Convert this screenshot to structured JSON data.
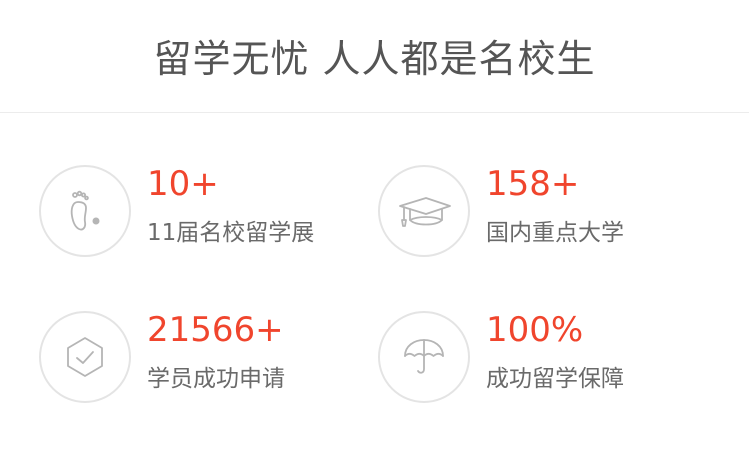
{
  "header": {
    "title": "留学无忧 人人都是名校生"
  },
  "stats": [
    {
      "value": "10+",
      "label": "11届名校留学展",
      "icon": "footprint-icon"
    },
    {
      "value": "158+",
      "label": "国内重点大学",
      "icon": "graduation-cap-icon"
    },
    {
      "value": "21566+",
      "label": "学员成功申请",
      "icon": "shield-check-icon"
    },
    {
      "value": "100%",
      "label": "成功留学保障",
      "icon": "umbrella-icon"
    }
  ],
  "colors": {
    "accent": "#f0452d",
    "title": "#555555",
    "label": "#6a6a6a",
    "icon_stroke": "#b5b5b5",
    "circle_border": "#e4e4e4"
  }
}
